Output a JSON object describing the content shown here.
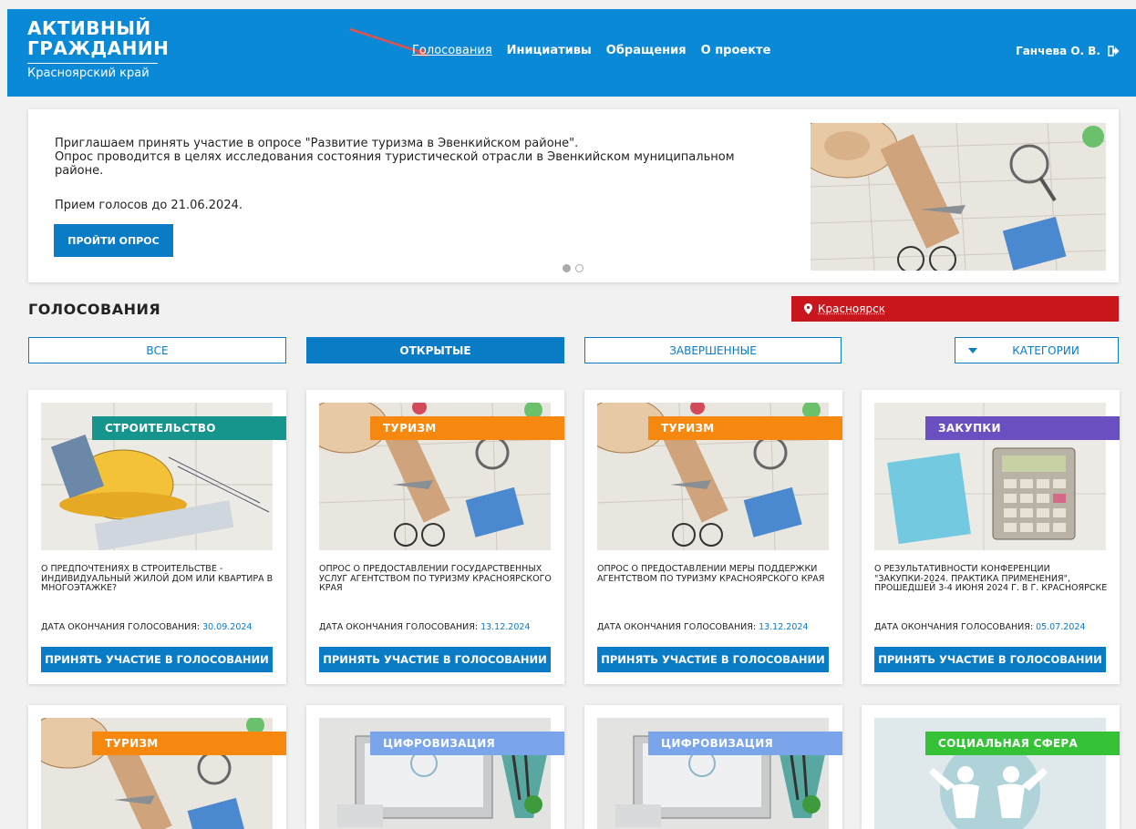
{
  "header": {
    "logo_line1": "АКТИВНЫЙ",
    "logo_line2": "ГРАЖДАНИН",
    "logo_line3": "Красноярский край",
    "nav": [
      "Голосования",
      "Инициативы",
      "Обращения",
      "О проекте"
    ],
    "user": "Ганчева О. В."
  },
  "banner": {
    "line1": "Приглашаем принять участие в опросе \"Развитие туризма в Эвенкийском районе\".",
    "line2": "Опрос проводится в целях исследования состояния туристической отрасли в Эвенкийском муниципальном районе.",
    "deadline": "Прием голосов до 21.06.2024.",
    "button": "ПРОЙТИ ОПРОС"
  },
  "section": {
    "title": "ГОЛОСОВАНИЯ",
    "city": "Красноярск"
  },
  "filters": {
    "all": "ВСЕ",
    "open": "ОТКРЫТЫЕ",
    "finished": "ЗАВЕРШЕННЫЕ",
    "categories": "КАТЕГОРИИ"
  },
  "cards": [
    {
      "tag": "СТРОИТЕЛЬСТВО",
      "title": "О ПРЕДПОЧТЕНИЯХ В СТРОИТЕЛЬСТВЕ - ИНДИВИДУАЛЬНЫЙ ЖИЛОЙ ДОМ ИЛИ КВАРТИРА В МНОГОЭТАЖКЕ?",
      "date_label": "ДАТА ОКОНЧАНИЯ ГОЛОСОВАНИЯ: ",
      "date": "30.09.2024",
      "button": "ПРИНЯТЬ УЧАСТИЕ В ГОЛОСОВАНИИ"
    },
    {
      "tag": "ТУРИЗМ",
      "title": "ОПРОС О ПРЕДОСТАВЛЕНИИ ГОСУДАРСТВЕННЫХ УСЛУГ АГЕНТСТВОМ ПО ТУРИЗМУ КРАСНОЯРСКОГО КРАЯ",
      "date_label": "ДАТА ОКОНЧАНИЯ ГОЛОСОВАНИЯ: ",
      "date": "13.12.2024",
      "button": "ПРИНЯТЬ УЧАСТИЕ В ГОЛОСОВАНИИ"
    },
    {
      "tag": "ТУРИЗМ",
      "title": "ОПРОС О ПРЕДОСТАВЛЕНИИ МЕРЫ ПОДДЕРЖКИ АГЕНТСТВОМ ПО ТУРИЗМУ КРАСНОЯРСКОГО КРАЯ",
      "date_label": "ДАТА ОКОНЧАНИЯ ГОЛОСОВАНИЯ: ",
      "date": "13.12.2024",
      "button": "ПРИНЯТЬ УЧАСТИЕ В ГОЛОСОВАНИИ"
    },
    {
      "tag": "ЗАКУПКИ",
      "title": "О РЕЗУЛЬТАТИВНОСТИ КОНФЕРЕНЦИИ \"ЗАКУПКИ-2024. ПРАКТИКА ПРИМЕНЕНИЯ\", ПРОШЕДШЕЙ 3-4 ИЮНЯ 2024 Г. В Г. КРАСНОЯРСКЕ",
      "date_label": "ДАТА ОКОНЧАНИЯ ГОЛОСОВАНИЯ: ",
      "date": "05.07.2024",
      "button": "ПРИНЯТЬ УЧАСТИЕ В ГОЛОСОВАНИИ"
    },
    {
      "tag": "ТУРИЗМ"
    },
    {
      "tag": "ЦИФРОВИЗАЦИЯ"
    },
    {
      "tag": "ЦИФРОВИЗАЦИЯ"
    },
    {
      "tag": "СОЦИАЛЬНАЯ СФЕРА"
    }
  ],
  "colors": {
    "header": "#0a8ad6",
    "primary": "#0a7cc6",
    "city_bar": "#c9161c",
    "tag_construction": "#16958d",
    "tag_tourism": "#f7880f",
    "tag_procurement": "#6a4fc1",
    "tag_digital": "#7aa5ea",
    "tag_social": "#35c236"
  }
}
